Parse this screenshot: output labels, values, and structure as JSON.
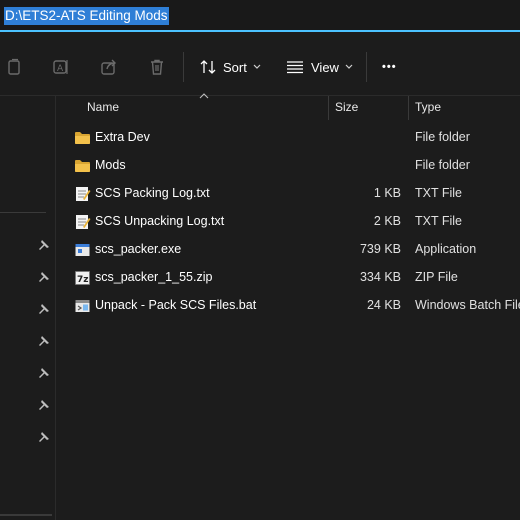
{
  "address": {
    "path": "D:\\ETS2-ATS Editing Mods"
  },
  "toolbar": {
    "sort_label": "Sort",
    "view_label": "View",
    "more_label": "•••"
  },
  "columns": {
    "name": "Name",
    "size": "Size",
    "type": "Type"
  },
  "files": [
    {
      "name": "Extra Dev",
      "size": "",
      "type": "File folder",
      "icon": "folder-icon"
    },
    {
      "name": "Mods",
      "size": "",
      "type": "File folder",
      "icon": "folder-icon"
    },
    {
      "name": "SCS Packing Log.txt",
      "size": "1 KB",
      "type": "TXT File",
      "icon": "text-file-icon"
    },
    {
      "name": "SCS Unpacking Log.txt",
      "size": "2 KB",
      "type": "TXT File",
      "icon": "text-file-icon"
    },
    {
      "name": "scs_packer.exe",
      "size": "739 KB",
      "type": "Application",
      "icon": "exe-file-icon"
    },
    {
      "name": "scs_packer_1_55.zip",
      "size": "334 KB",
      "type": "ZIP File",
      "icon": "zip-file-icon"
    },
    {
      "name": "Unpack - Pack SCS Files.bat",
      "size": "24 KB",
      "type": "Windows Batch File",
      "icon": "bat-file-icon"
    }
  ],
  "colors": {
    "accent": "#4cc2ff",
    "selection": "#2f7fd6",
    "folder": "#f3c14b"
  }
}
